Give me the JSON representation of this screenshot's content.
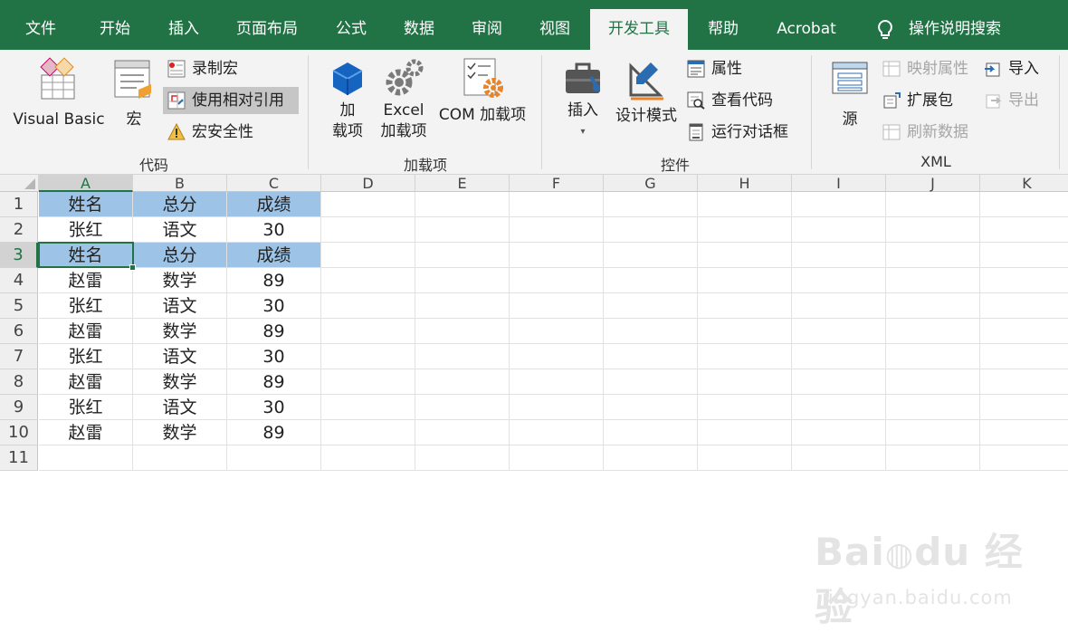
{
  "tabs": [
    {
      "label": "文件"
    },
    {
      "label": "开始"
    },
    {
      "label": "插入"
    },
    {
      "label": "页面布局"
    },
    {
      "label": "公式"
    },
    {
      "label": "数据"
    },
    {
      "label": "审阅"
    },
    {
      "label": "视图"
    },
    {
      "label": "开发工具",
      "active": true
    },
    {
      "label": "帮助"
    },
    {
      "label": "Acrobat"
    }
  ],
  "tellme": {
    "label": "操作说明搜索",
    "icon": "lightbulb-icon"
  },
  "ribbon": {
    "code": {
      "group_label": "代码",
      "visual_basic": "Visual Basic",
      "macros": "宏",
      "record_macro": "录制宏",
      "relative_refs": "使用相对引用",
      "macro_security": "宏安全性"
    },
    "addins": {
      "group_label": "加载项",
      "addins_line1": "加",
      "addins_line2": "载项",
      "excel_line1": "Excel",
      "excel_line2": "加载项",
      "com_addins": "COM 加载项"
    },
    "controls": {
      "group_label": "控件",
      "insert": "插入",
      "design_mode": "设计模式",
      "properties": "属性",
      "view_code": "查看代码",
      "run_dialog": "运行对话框"
    },
    "xml": {
      "group_label": "XML",
      "source": "源",
      "map_properties": "映射属性",
      "expansion_packs": "扩展包",
      "refresh_data": "刷新数据",
      "import": "导入",
      "export": "导出"
    }
  },
  "sheet": {
    "columns": [
      "A",
      "B",
      "C",
      "D",
      "E",
      "F",
      "G",
      "H",
      "I",
      "J",
      "K"
    ],
    "selected_column": "A",
    "selected_row": "3",
    "rows": [
      {
        "num": "1",
        "cells": [
          "姓名",
          "总分",
          "成绩"
        ],
        "header": true
      },
      {
        "num": "2",
        "cells": [
          "张红",
          "语文",
          "30"
        ]
      },
      {
        "num": "3",
        "cells": [
          "姓名",
          "总分",
          "成绩"
        ],
        "header": true
      },
      {
        "num": "4",
        "cells": [
          "赵雷",
          "数学",
          "89"
        ]
      },
      {
        "num": "5",
        "cells": [
          "张红",
          "语文",
          "30"
        ]
      },
      {
        "num": "6",
        "cells": [
          "赵雷",
          "数学",
          "89"
        ]
      },
      {
        "num": "7",
        "cells": [
          "张红",
          "语文",
          "30"
        ]
      },
      {
        "num": "8",
        "cells": [
          "赵雷",
          "数学",
          "89"
        ]
      },
      {
        "num": "9",
        "cells": [
          "张红",
          "语文",
          "30"
        ]
      },
      {
        "num": "10",
        "cells": [
          "赵雷",
          "数学",
          "89"
        ]
      },
      {
        "num": "11",
        "cells": [
          "",
          "",
          ""
        ]
      }
    ]
  },
  "colors": {
    "accent": "#217346",
    "header_fill": "#9dc3e6"
  }
}
